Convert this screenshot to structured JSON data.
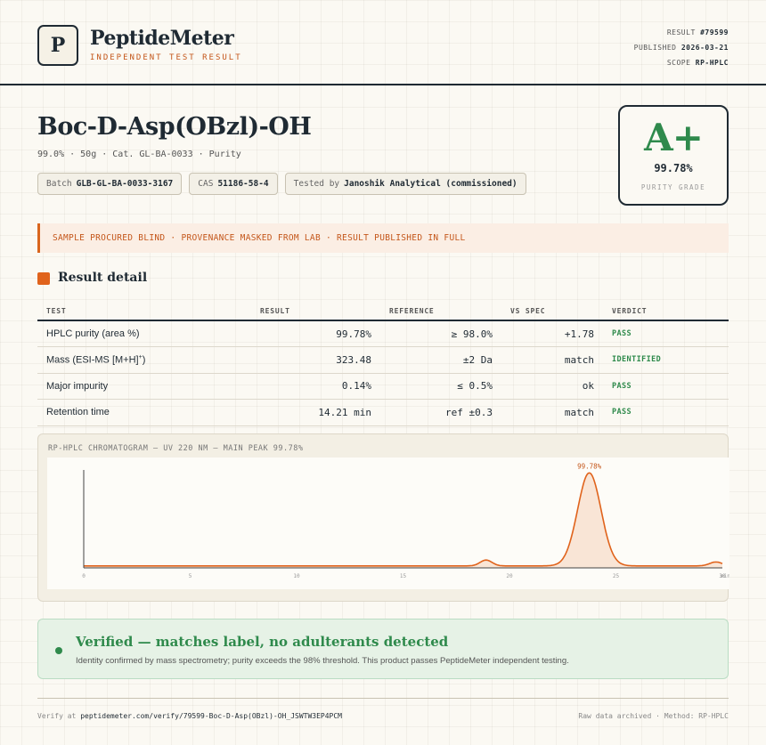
{
  "header": {
    "logo_letter": "P",
    "brand": "PeptideMeter",
    "brand_sub": "INDEPENDENT TEST RESULT",
    "meta": [
      {
        "label": "RESULT",
        "value": "#79599"
      },
      {
        "label": "PUBLISHED",
        "value": "2026-03-21"
      },
      {
        "label": "SCOPE",
        "value": "RP-HPLC"
      }
    ]
  },
  "product": {
    "title": "Boc-D-Asp(OBzl)-OH",
    "subline": "99.0% · 50g · Cat. GL-BA-0033 · Purity",
    "chips": [
      {
        "label": "Batch",
        "value": "GLB-GL-BA-0033-3167"
      },
      {
        "label": "CAS",
        "value": "51186-58-4"
      },
      {
        "label": "Tested by",
        "value": "Janoshik Analytical (commissioned)"
      }
    ]
  },
  "grade": {
    "letter": "A+",
    "percent": "99.78%",
    "label": "PURITY GRADE",
    "color": "#2f8a4c"
  },
  "banner": "SAMPLE PROCURED BLIND · PROVENANCE MASKED FROM LAB · RESULT PUBLISHED IN FULL",
  "section_title": "Result detail",
  "table": {
    "headers": [
      "TEST",
      "RESULT",
      "REFERENCE",
      "VS SPEC",
      "VERDICT"
    ],
    "rows": [
      {
        "test": "HPLC purity (area %)",
        "result": "99.78%",
        "reference": "≥ 98.0%",
        "vs_spec": "+1.78",
        "verdict": "PASS"
      },
      {
        "test": "Mass (ESI-MS [M+H]",
        "test_sup": "+",
        "test_end": ")",
        "result": "323.48",
        "reference": "±2 Da",
        "vs_spec": "match",
        "verdict": "IDENTIFIED"
      },
      {
        "test": "Major impurity",
        "result": "0.14%",
        "reference": "≤ 0.5%",
        "vs_spec": "ok",
        "verdict": "PASS"
      },
      {
        "test": "Retention time",
        "result": "14.21 min",
        "reference": "ref ±0.3",
        "vs_spec": "match",
        "verdict": "PASS"
      }
    ]
  },
  "chart_title": "RP-HPLC CHROMATOGRAM — UV 220 NM — MAIN PEAK 99.78%",
  "chart_data": {
    "type": "line",
    "title": "RP-HPLC CHROMATOGRAM — UV 220 NM — MAIN PEAK 99.78%",
    "xlabel": "",
    "ylabel": "",
    "xlim": [
      0,
      30
    ],
    "x_ticks": [
      "0",
      "5",
      "10",
      "15",
      "20",
      "25",
      "30"
    ],
    "x_tick_values": [
      0,
      5,
      10,
      15,
      20,
      25,
      30
    ],
    "xunit_label": "min",
    "baseline": 2,
    "ylim": [
      0,
      100
    ],
    "peaks": [
      {
        "center": 18.9,
        "height": 6,
        "width": 0.28
      },
      {
        "center": 23.75,
        "height": 95,
        "width": 0.55,
        "label": "99.78%"
      },
      {
        "center": 29.7,
        "height": 4,
        "width": 0.3
      }
    ],
    "line_color": "#e0631c",
    "fill_color": "#f7dcc8",
    "grid": false
  },
  "verified": {
    "title": "Verified — matches label, no adulterants detected",
    "text": "Identity confirmed by mass spectrometry; purity exceeds the 98% threshold. This product passes PeptideMeter independent testing."
  },
  "footer": {
    "verify_prefix": "Verify at",
    "verify_url": "peptidemeter.com/verify/79599-Boc-D-Asp(OBzl)-OH_JSWTW3EP4PCM",
    "right": "Raw data archived · Method: RP-HPLC"
  }
}
